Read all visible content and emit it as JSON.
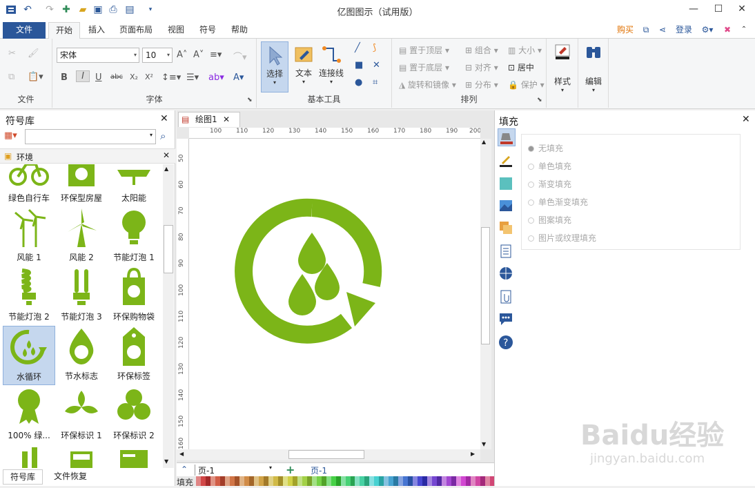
{
  "app": {
    "title": "亿图图示（试用版）"
  },
  "tabs": {
    "file": "文件",
    "items": [
      "开始",
      "插入",
      "页面布局",
      "视图",
      "符号",
      "帮助"
    ],
    "buy": "购买",
    "login": "登录"
  },
  "ribbon": {
    "groups": {
      "file": "文件",
      "font": "字体",
      "basic_tools": "基本工具",
      "arrange": "排列"
    },
    "font_name": "宋体",
    "font_size": "10",
    "tools": {
      "select": "选择",
      "text": "文本",
      "connector": "连接线"
    },
    "arrange": {
      "bring_front": "置于顶层",
      "send_back": "置于底层",
      "rotate": "旋转和镜像",
      "group": "组合",
      "align": "对齐",
      "distribute": "分布",
      "size": "大小",
      "center": "居中",
      "protect": "保护"
    },
    "style": "样式",
    "edit": "编辑"
  },
  "library": {
    "title": "符号库",
    "category": "环境",
    "symbols": [
      [
        "绿色自行车",
        "环保型房屋",
        "太阳能"
      ],
      [
        "风能 1",
        "风能 2",
        "节能灯泡 1"
      ],
      [
        "节能灯泡 2",
        "节能灯泡 3",
        "环保购物袋"
      ],
      [
        "水循环",
        "节水标志",
        "环保标签"
      ],
      [
        "100% 绿...",
        "环保标识 1",
        "环保标识 2"
      ]
    ],
    "bottom_tabs": [
      "符号库",
      "文件恢复"
    ]
  },
  "document": {
    "tab": "绘图1",
    "ruler_h": [
      "100",
      "110",
      "120",
      "130",
      "140",
      "150",
      "160",
      "170",
      "180",
      "190",
      "200"
    ],
    "ruler_v": [
      "50",
      "60",
      "70",
      "80",
      "90",
      "100",
      "110",
      "120",
      "130",
      "140",
      "150",
      "160"
    ],
    "page_select": "页-1",
    "page_tab": "页-1",
    "fill_label": "填充"
  },
  "fill_panel": {
    "title": "填充",
    "options": [
      "无填充",
      "单色填充",
      "渐变填充",
      "单色渐变填充",
      "图案填充",
      "图片或纹理填充"
    ]
  },
  "colors": {
    "accent": "#2b579a",
    "green": "#7cb518"
  },
  "watermark": {
    "text1": "Baidu经验",
    "text2": "jingyan.baidu.com"
  }
}
